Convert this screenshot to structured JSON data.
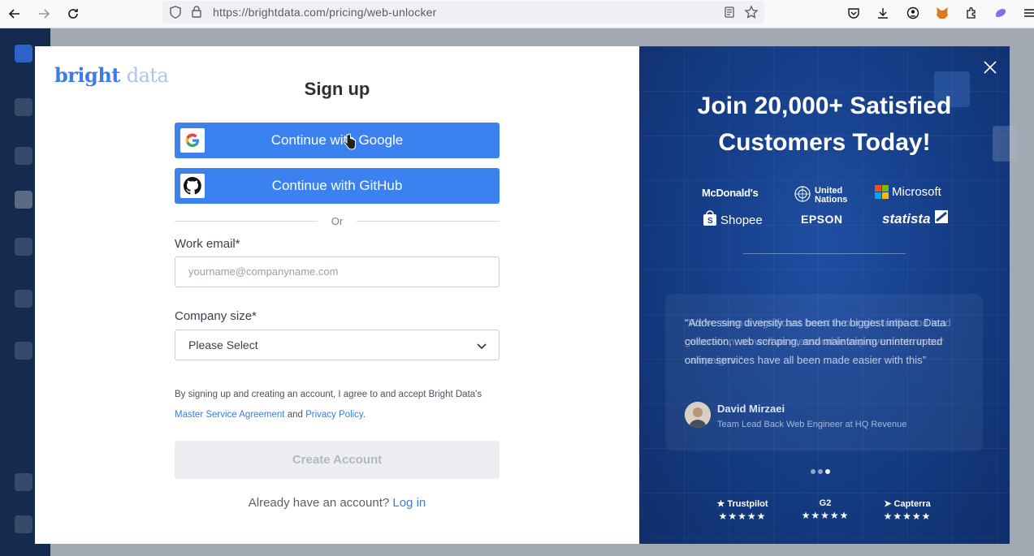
{
  "browser": {
    "url_host": "https://brightdata.com",
    "url_path": "/pricing/web-unlocker"
  },
  "logo": {
    "bright": "bright",
    "data": "data"
  },
  "signup": {
    "title": "Sign up",
    "google_label": "Continue with Google",
    "github_label": "Continue with GitHub",
    "or_text": "Or",
    "email_label": "Work email*",
    "email_placeholder": "yourname@companyname.com",
    "company_label": "Company size*",
    "company_value": "Please Select",
    "terms_text": "By signing up and creating an account, I agree to and accept Bright Data's",
    "terms_link1": "Master Service Agreement",
    "terms_and": "and",
    "terms_link2": "Privacy Policy.",
    "create_label": "Create Account",
    "have_account": "Already have an account?",
    "login_label": "Log in"
  },
  "promo": {
    "headline_line1": "Join 20,000+ Satisfied",
    "headline_line2": "Customers Today!",
    "brands": {
      "mcdonalds": "McDonald's",
      "un_line1": "United",
      "un_line2": "Nations",
      "microsoft": "Microsoft",
      "shopee": "Shopee",
      "epson": "EPSON",
      "statista": "statista"
    },
    "quote_primary": "“We've seen a significant boost in our site traffic and lead generation, as well as measurable improvements in our campaigns.”",
    "quote_secondary": "“Addressing diversity has been the biggest impact. Data collection, web scraping, and maintaining uninterrupted online services have all been made easier with this”",
    "person_name": "David Mirzaei",
    "person_role": "Team Lead Back Web Engineer at HQ Revenue",
    "ratings": [
      {
        "name": "Trustpilot",
        "stars": "★★★★★"
      },
      {
        "name": "G2",
        "stars": "★★★★★"
      },
      {
        "name": "Capterra",
        "stars": "★★★★★"
      }
    ]
  },
  "colors": {
    "primary_button": "#3b82f0",
    "link": "#3b7be0",
    "promo_bg": "#17408c"
  }
}
